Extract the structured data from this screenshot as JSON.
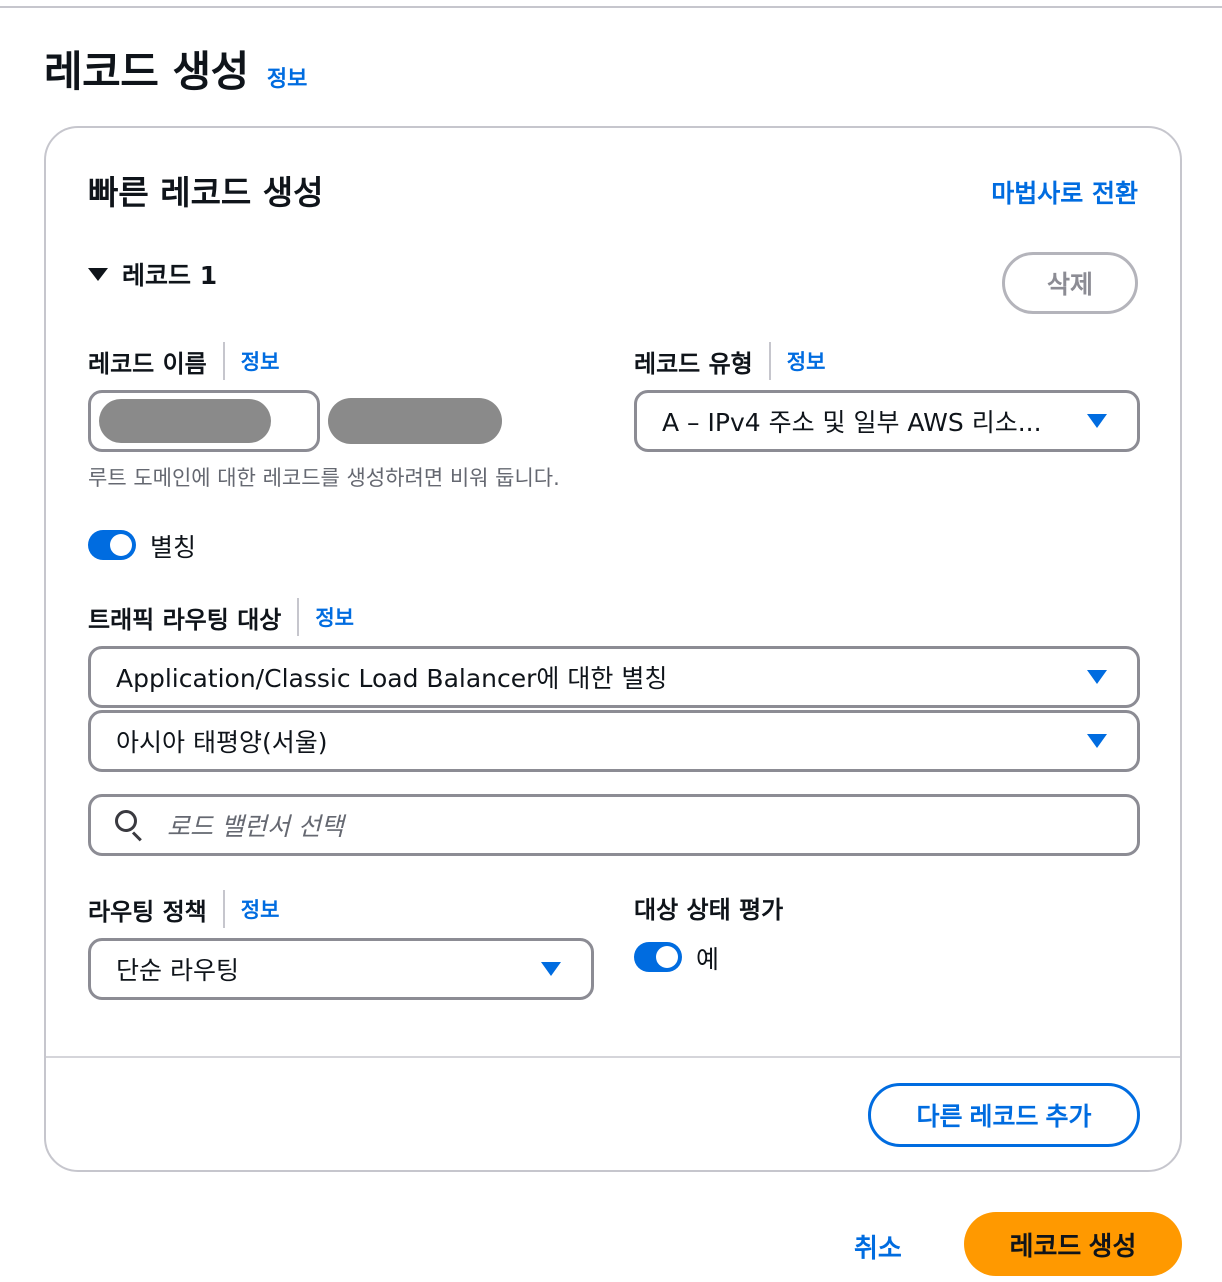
{
  "header": {
    "title": "레코드 생성",
    "info": "정보"
  },
  "card": {
    "title": "빠른 레코드 생성",
    "wizard_link": "마법사로 전환",
    "record_toggle_label": "레코드 1",
    "delete_label": "삭제"
  },
  "record_name": {
    "label": "레코드 이름",
    "info": "정보",
    "hint": "루트 도메인에 대한 레코드를 생성하려면 비워 둡니다."
  },
  "record_type": {
    "label": "레코드 유형",
    "info": "정보",
    "value": "A – IPv4 주소 및 일부 AWS 리소..."
  },
  "alias": {
    "label": "별칭",
    "enabled": true
  },
  "traffic_target": {
    "label": "트래픽 라우팅 대상",
    "info": "정보",
    "endpoint_value": "Application/Classic Load Balancer에 대한 별칭",
    "region_value": "아시아 태평양(서울)",
    "search_placeholder": "로드 밸런서 선택"
  },
  "routing_policy": {
    "label": "라우팅 정책",
    "info": "정보",
    "value": "단순 라우팅"
  },
  "health": {
    "label": "대상 상태 평가",
    "toggle_label": "예",
    "enabled": true
  },
  "actions": {
    "add_record": "다른 레코드 추가",
    "cancel": "취소",
    "create": "레코드 생성"
  },
  "colors": {
    "link": "#006ce0",
    "primary_button": "#ff9900",
    "border": "#8c8c94"
  },
  "icons": [
    "caret-down-icon",
    "dropdown-arrow-icon",
    "search-icon"
  ]
}
